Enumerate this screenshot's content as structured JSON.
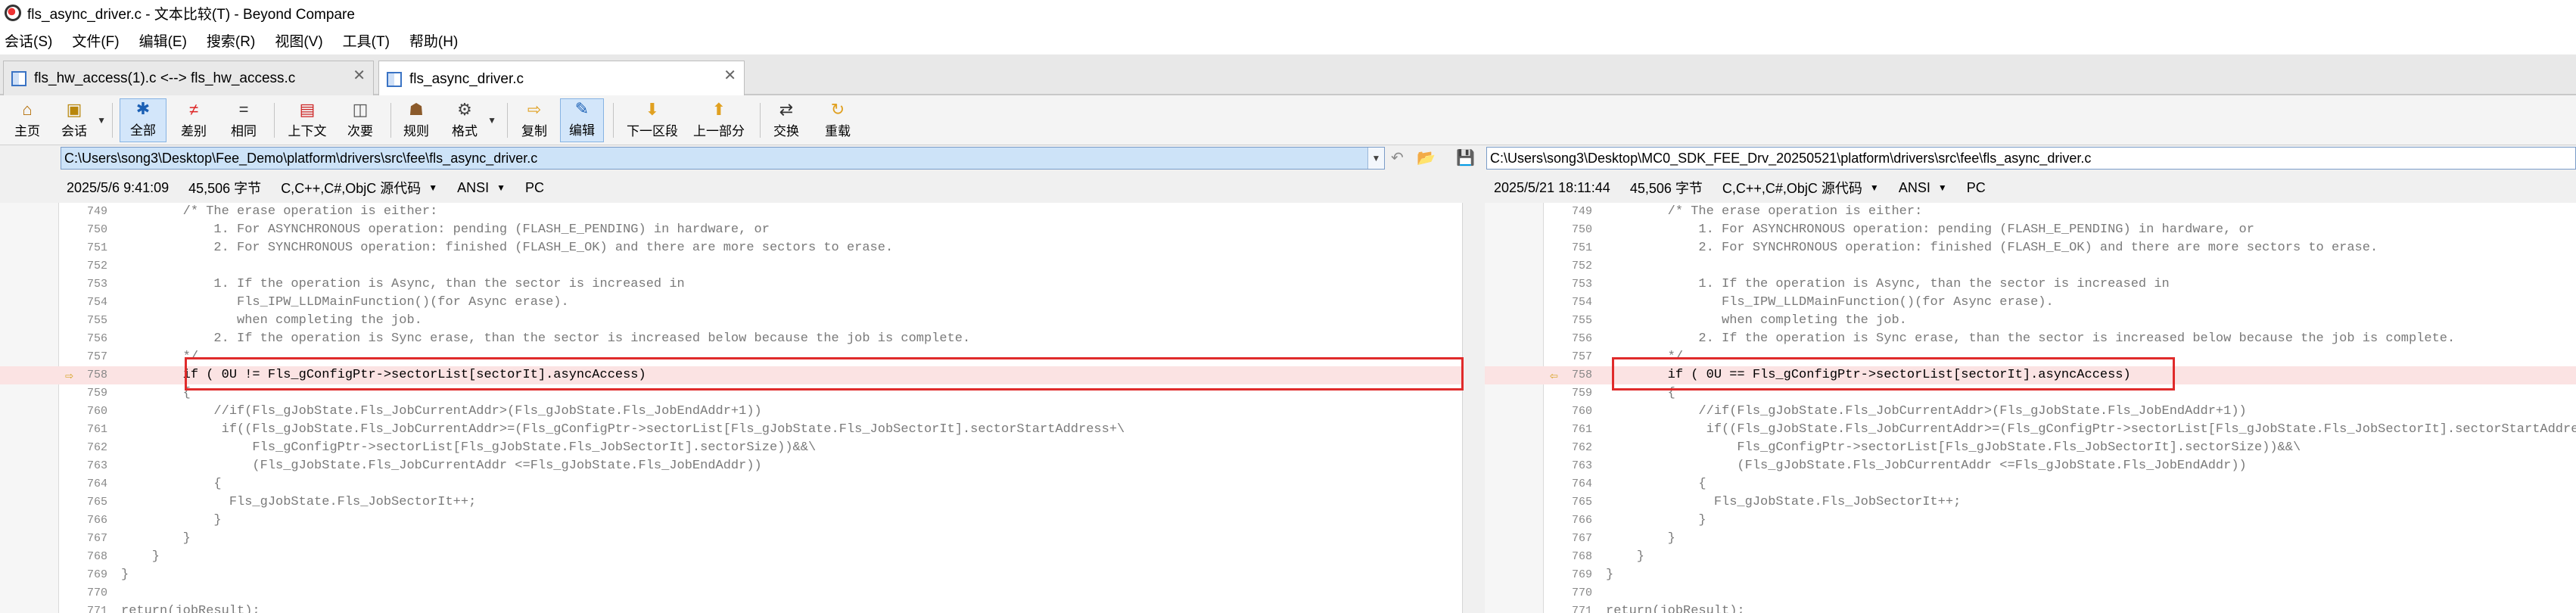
{
  "window": {
    "title": "fls_async_driver.c - 文本比较(T) - Beyond Compare"
  },
  "menu": [
    "会话(S)",
    "文件(F)",
    "编辑(E)",
    "搜索(R)",
    "视图(V)",
    "工具(T)",
    "帮助(H)"
  ],
  "tabs": [
    {
      "label": "fls_hw_access(1).c <--> fls_hw_access.c"
    },
    {
      "label": "fls_async_driver.c"
    }
  ],
  "toolbar": {
    "home": "主页",
    "session": "会话",
    "all": "全部",
    "diffs": "差别",
    "same": "相同",
    "context": "上下文",
    "minor": "次要",
    "rules": "规则",
    "format": "格式",
    "copy": "复制",
    "edit": "编辑",
    "next_section": "下一区段",
    "prev_section": "上一部分",
    "swap": "交换",
    "reload": "重载"
  },
  "left": {
    "path": "C:\\Users\\song3\\Desktop\\Fee_Demo\\platform\\drivers\\src\\fee\\fls_async_driver.c",
    "date": "2025/5/6 9:41:09",
    "size": "45,506 字节",
    "language": "C,C++,C#,ObjC 源代码",
    "encoding": "ANSI",
    "line_ending": "PC"
  },
  "right": {
    "path": "C:\\Users\\song3\\Desktop\\MC0_SDK_FEE_Drv_20250521\\platform\\drivers\\src\\fee\\fls_async_driver.c",
    "date": "2025/5/21 18:11:44",
    "size": "45,506 字节",
    "language": "C,C++,C#,ObjC 源代码",
    "encoding": "ANSI",
    "line_ending": "PC"
  },
  "code_left": [
    {
      "n": "749",
      "t": "        /* The erase operation is either:"
    },
    {
      "n": "750",
      "t": "            1. For ASYNCHRONOUS operation: pending (FLASH_E_PENDING) in hardware, or"
    },
    {
      "n": "751",
      "t": "            2. For SYNCHRONOUS operation: finished (FLASH_E_OK) and there are more sectors to erase."
    },
    {
      "n": "752",
      "t": ""
    },
    {
      "n": "753",
      "t": "            1. If the operation is Async, than the sector is increased in"
    },
    {
      "n": "754",
      "t": "               Fls_IPW_LLDMainFunction()(for Async erase)."
    },
    {
      "n": "755",
      "t": "               when completing the job."
    },
    {
      "n": "756",
      "t": "            2. If the operation is Sync erase, than the sector is increased below because the job is complete."
    },
    {
      "n": "757",
      "t": "        */"
    },
    {
      "n": "758",
      "t": "        if ( 0U != Fls_gConfigPtr->sectorList[sectorIt].asyncAccess)"
    },
    {
      "n": "759",
      "t": "        {"
    },
    {
      "n": "760",
      "t": "            //if(Fls_gJobState.Fls_JobCurrentAddr>(Fls_gJobState.Fls_JobEndAddr+1))"
    },
    {
      "n": "761",
      "t": "             if((Fls_gJobState.Fls_JobCurrentAddr>=(Fls_gConfigPtr->sectorList[Fls_gJobState.Fls_JobSectorIt].sectorStartAddress+\\"
    },
    {
      "n": "762",
      "t": "                 Fls_gConfigPtr->sectorList[Fls_gJobState.Fls_JobSectorIt].sectorSize))&&\\"
    },
    {
      "n": "763",
      "t": "                 (Fls_gJobState.Fls_JobCurrentAddr <=Fls_gJobState.Fls_JobEndAddr))"
    },
    {
      "n": "764",
      "t": "            {"
    },
    {
      "n": "765",
      "t": "              Fls_gJobState.Fls_JobSectorIt++;"
    },
    {
      "n": "766",
      "t": "            }"
    },
    {
      "n": "767",
      "t": "        }"
    },
    {
      "n": "768",
      "t": "    }"
    },
    {
      "n": "769",
      "t": "}"
    },
    {
      "n": "770",
      "t": ""
    },
    {
      "n": "771",
      "t": "return(jobResult);"
    }
  ],
  "code_right": [
    {
      "n": "749",
      "t": "        /* The erase operation is either:"
    },
    {
      "n": "750",
      "t": "            1. For ASYNCHRONOUS operation: pending (FLASH_E_PENDING) in hardware, or"
    },
    {
      "n": "751",
      "t": "            2. For SYNCHRONOUS operation: finished (FLASH_E_OK) and there are more sectors to erase."
    },
    {
      "n": "752",
      "t": ""
    },
    {
      "n": "753",
      "t": "            1. If the operation is Async, than the sector is increased in"
    },
    {
      "n": "754",
      "t": "               Fls_IPW_LLDMainFunction()(for Async erase)."
    },
    {
      "n": "755",
      "t": "               when completing the job."
    },
    {
      "n": "756",
      "t": "            2. If the operation is Sync erase, than the sector is increased below because the job is complete."
    },
    {
      "n": "757",
      "t": "        */"
    },
    {
      "n": "758",
      "t": "        if ( 0U == Fls_gConfigPtr->sectorList[sectorIt].asyncAccess)"
    },
    {
      "n": "759",
      "t": "        {"
    },
    {
      "n": "760",
      "t": "            //if(Fls_gJobState.Fls_JobCurrentAddr>(Fls_gJobState.Fls_JobEndAddr+1))"
    },
    {
      "n": "761",
      "t": "             if((Fls_gJobState.Fls_JobCurrentAddr>=(Fls_gConfigPtr->sectorList[Fls_gJobState.Fls_JobSectorIt].sectorStartAddre"
    },
    {
      "n": "762",
      "t": "                 Fls_gConfigPtr->sectorList[Fls_gJobState.Fls_JobSectorIt].sectorSize))&&\\"
    },
    {
      "n": "763",
      "t": "                 (Fls_gJobState.Fls_JobCurrentAddr <=Fls_gJobState.Fls_JobEndAddr))"
    },
    {
      "n": "764",
      "t": "            {"
    },
    {
      "n": "765",
      "t": "              Fls_gJobState.Fls_JobSectorIt++;"
    },
    {
      "n": "766",
      "t": "            }"
    },
    {
      "n": "767",
      "t": "        }"
    },
    {
      "n": "768",
      "t": "    }"
    },
    {
      "n": "769",
      "t": "}"
    },
    {
      "n": "770",
      "t": ""
    },
    {
      "n": "771",
      "t": "return(jobResult);"
    }
  ],
  "icons": {
    "home": "home-icon",
    "session": "session-icon",
    "all": "asterisk-icon",
    "diffs": "not-equal-icon",
    "same": "equal-icon",
    "context": "context-icon",
    "minor": "minor-icon",
    "rules": "rules-icon",
    "format": "format-icon",
    "copy": "copy-arrow-icon",
    "edit": "pencil-icon",
    "next_section": "down-arrow-icon",
    "prev_section": "up-arrow-icon",
    "swap": "swap-icon",
    "reload": "reload-icon",
    "diff_marker": "diff-arrow-icon"
  },
  "colors": {
    "changed_line_bg": "#fbe3e3",
    "highlight_box": "#e02b2b",
    "active_tool_bg": "#d3e6fa"
  }
}
